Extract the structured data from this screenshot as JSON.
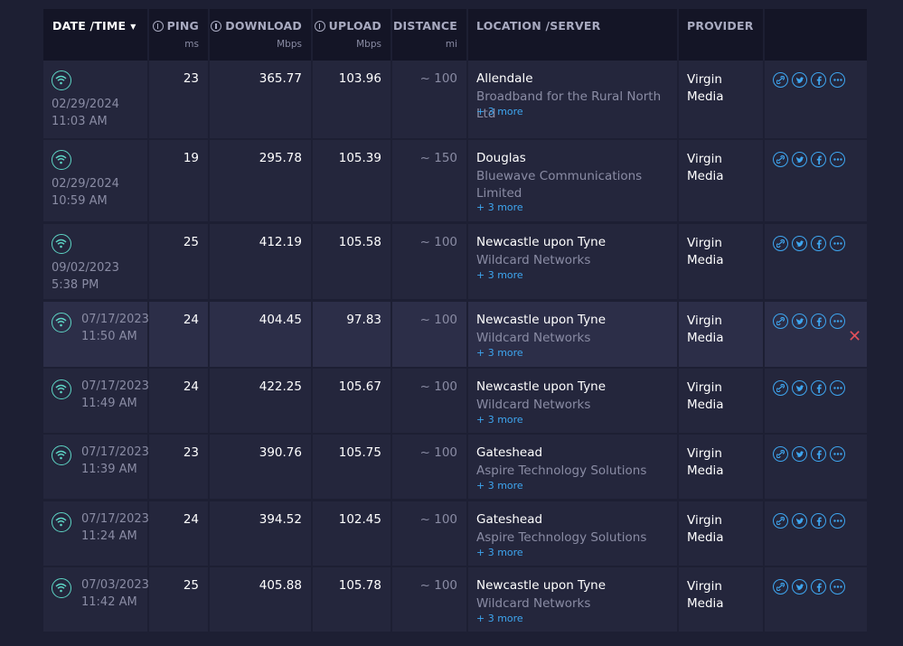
{
  "header": {
    "datetime": "DATE /TIME",
    "ping": "PING",
    "ping_unit": "ms",
    "download": "DOWNLOAD",
    "download_unit": "Mbps",
    "upload": "UPLOAD",
    "upload_unit": "Mbps",
    "distance": "DISTANCE",
    "distance_unit": "mi",
    "location": "LOCATION /SERVER",
    "provider": "PROVIDER"
  },
  "rows": [
    {
      "date": "02/29/2024",
      "time": "11:03 AM",
      "ping": "23",
      "download": "365.77",
      "upload": "103.96",
      "distance": "~ 100",
      "city": "Allendale",
      "isp": "Broadband for the Rural North Ltd",
      "more": "+ 3 more",
      "provider_1": "Virgin",
      "provider_2": "Media"
    },
    {
      "date": "02/29/2024",
      "time": "10:59 AM",
      "ping": "19",
      "download": "295.78",
      "upload": "105.39",
      "distance": "~ 150",
      "city": "Douglas",
      "isp": "Bluewave Communications Limited",
      "more": "+ 3 more",
      "provider_1": "Virgin",
      "provider_2": "Media"
    },
    {
      "date": "09/02/2023",
      "time": "5:38 PM",
      "ping": "25",
      "download": "412.19",
      "upload": "105.58",
      "distance": "~ 100",
      "city": "Newcastle upon Tyne",
      "isp": "Wildcard Networks",
      "more": "+ 3 more",
      "provider_1": "Virgin",
      "provider_2": "Media"
    },
    {
      "date": "07/17/2023",
      "time": "11:50 AM",
      "ping": "24",
      "download": "404.45",
      "upload": "97.83",
      "distance": "~ 100",
      "city": "Newcastle upon Tyne",
      "isp": "Wildcard Networks",
      "more": "+ 3 more",
      "provider_1": "Virgin",
      "provider_2": "Media"
    },
    {
      "date": "07/17/2023",
      "time": "11:49 AM",
      "ping": "24",
      "download": "422.25",
      "upload": "105.67",
      "distance": "~ 100",
      "city": "Newcastle upon Tyne",
      "isp": "Wildcard Networks",
      "more": "+ 3 more",
      "provider_1": "Virgin",
      "provider_2": "Media"
    },
    {
      "date": "07/17/2023",
      "time": "11:39 AM",
      "ping": "23",
      "download": "390.76",
      "upload": "105.75",
      "distance": "~ 100",
      "city": "Gateshead",
      "isp": "Aspire Technology Solutions",
      "more": "+ 3 more",
      "provider_1": "Virgin",
      "provider_2": "Media"
    },
    {
      "date": "07/17/2023",
      "time": "11:24 AM",
      "ping": "24",
      "download": "394.52",
      "upload": "102.45",
      "distance": "~ 100",
      "city": "Gateshead",
      "isp": "Aspire Technology Solutions",
      "more": "+ 3 more",
      "provider_1": "Virgin",
      "provider_2": "Media"
    },
    {
      "date": "07/03/2023",
      "time": "11:42 AM",
      "ping": "25",
      "download": "405.88",
      "upload": "105.78",
      "distance": "~ 100",
      "city": "Newcastle upon Tyne",
      "isp": "Wildcard Networks",
      "more": "+ 3 more",
      "provider_1": "Virgin",
      "provider_2": "Media"
    }
  ],
  "colors": {
    "background": "#1d1f33",
    "header_bg": "#141526",
    "row_bg": "#24263c",
    "row_highlight": "#2c2e48",
    "wifi_accent": "#5ed6c6",
    "link_accent": "#3ea6f0",
    "delete_red": "#e0505a"
  },
  "icons": {
    "wifi": "wifi-icon",
    "link": "link-icon",
    "twitter": "twitter-icon",
    "facebook": "facebook-icon",
    "more": "more-icon",
    "delete": "close-icon"
  }
}
